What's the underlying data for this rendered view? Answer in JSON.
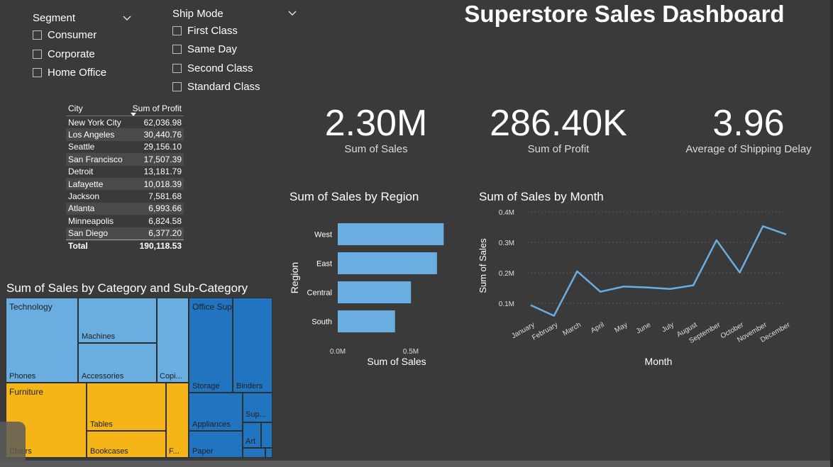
{
  "title": "Superstore Sales Dashboard",
  "segment_slicer": {
    "title": "Segment",
    "options": [
      "Consumer",
      "Corporate",
      "Home Office"
    ]
  },
  "shipmode_slicer": {
    "title": "Ship Mode",
    "options": [
      "First Class",
      "Same Day",
      "Second Class",
      "Standard Class"
    ]
  },
  "city_table": {
    "headers": [
      "City",
      "Sum of Profit"
    ],
    "rows": [
      [
        "New York City",
        "62,036.98"
      ],
      [
        "Los Angeles",
        "30,440.76"
      ],
      [
        "Seattle",
        "29,156.10"
      ],
      [
        "San Francisco",
        "17,507.39"
      ],
      [
        "Detroit",
        "13,181.79"
      ],
      [
        "Lafayette",
        "10,018.39"
      ],
      [
        "Jackson",
        "7,581.68"
      ],
      [
        "Atlanta",
        "6,993.66"
      ],
      [
        "Minneapolis",
        "6,824.58"
      ],
      [
        "San Diego",
        "6,377.20"
      ]
    ],
    "total_label": "Total",
    "total_value": "190,118.53"
  },
  "kpis": [
    {
      "value": "2.30M",
      "label": "Sum of Sales"
    },
    {
      "value": "286.40K",
      "label": "Sum of Profit"
    },
    {
      "value": "3.96",
      "label": "Average of Shipping Delay"
    }
  ],
  "treemap": {
    "title": "Sum of Sales by Category and Sub-Category",
    "categories": [
      "Technology",
      "Furniture",
      "Office Supplies"
    ],
    "cells": [
      "Machines",
      "Phones",
      "Accessories",
      "Copi...",
      "Tables",
      "Chairs",
      "Bookcases",
      "F...",
      "Storage",
      "Binders",
      "Appliances",
      "Sup...",
      "Art",
      "Paper"
    ],
    "colors": {
      "Technology": "#6aade0",
      "Furniture": "#f5b517",
      "Office Supplies": "#2174c0"
    }
  },
  "chart_data": [
    {
      "type": "bar",
      "orientation": "horizontal",
      "title": "Sum of Sales by Region",
      "xlabel": "Sum of Sales",
      "ylabel": "Region",
      "categories": [
        "West",
        "East",
        "Central",
        "South"
      ],
      "values": [
        725000,
        679000,
        501000,
        392000
      ],
      "x_ticks": [
        "0.0M",
        "0.5M"
      ],
      "xlim": [
        0,
        800000
      ],
      "color": "#6aade0"
    },
    {
      "type": "line",
      "title": "Sum of Sales by Month",
      "xlabel": "Month",
      "ylabel": "Sum of Sales",
      "x": [
        "January",
        "February",
        "March",
        "April",
        "May",
        "June",
        "July",
        "August",
        "September",
        "October",
        "November",
        "December"
      ],
      "values": [
        94000,
        59000,
        205000,
        138000,
        155000,
        152000,
        147000,
        159000,
        307000,
        201000,
        353000,
        326000
      ],
      "y_ticks": [
        "0.1M",
        "0.2M",
        "0.3M",
        "0.4M"
      ],
      "ylim": [
        0,
        400000
      ],
      "grid": true,
      "color": "#6aade0"
    }
  ]
}
